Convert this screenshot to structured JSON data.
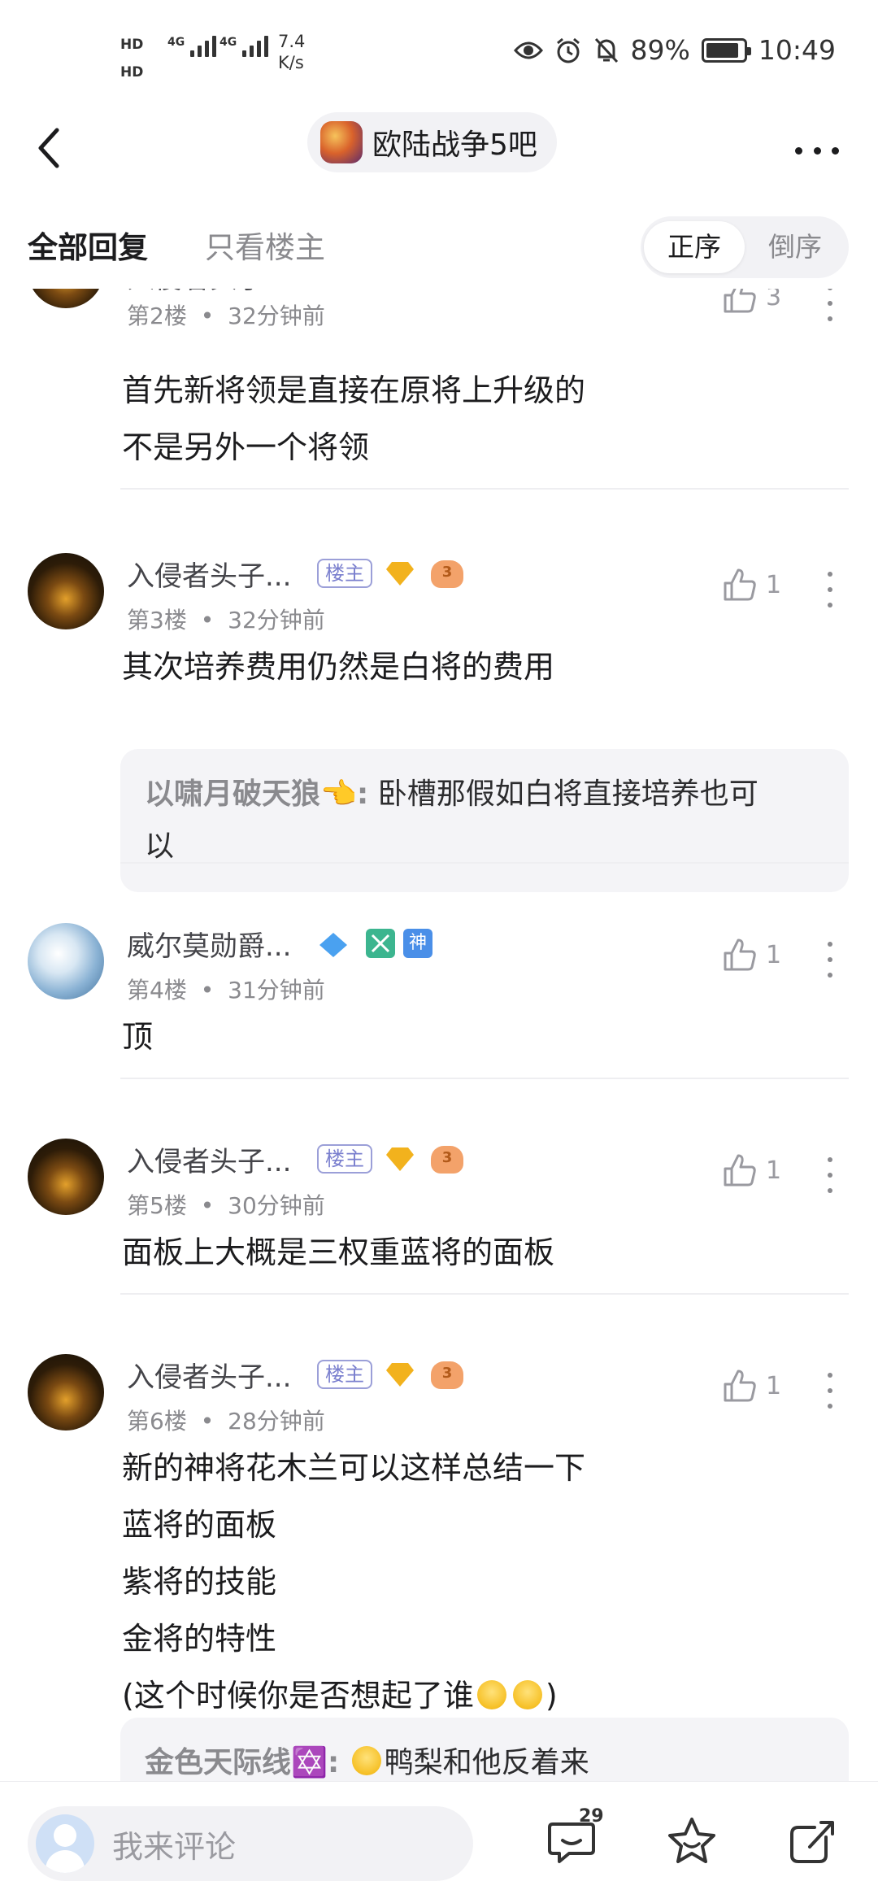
{
  "status_bar": {
    "hd1": "HD",
    "hd2": "HD",
    "sim1": "4G",
    "sim2": "4G",
    "speed_value": "7.4",
    "speed_unit": "K/s",
    "battery": "89%",
    "battery_level": 0.89,
    "time": "10:49",
    "icons": [
      "eye-icon",
      "alarm-icon",
      "bell-off-icon"
    ]
  },
  "header": {
    "forum_name": "欧陆战争5吧"
  },
  "tabs": {
    "all": "全部回复",
    "op_only": "只看楼主",
    "sort_asc": "正序",
    "sort_desc": "倒序"
  },
  "owner_badge": "楼主",
  "posts": [
    {
      "username": "入侵者头子...",
      "floor": "第2楼",
      "time": "32分钟前",
      "likes": "3",
      "lines": [
        "首先新将领是直接在原将上升级的",
        "不是另外一个将领"
      ]
    },
    {
      "username": "入侵者头子...",
      "floor": "第3楼",
      "time": "32分钟前",
      "likes": "1",
      "level": "11",
      "pad_level": "3",
      "lines": [
        "其次培养费用仍然是白将的费用"
      ],
      "reply": {
        "user": "以啸月破天狼👈:",
        "text_1": "卧槽那假如白将直接培养也可",
        "text_2": "以"
      }
    },
    {
      "username": "威尔莫勋爵...",
      "floor": "第4楼",
      "time": "31分钟前",
      "likes": "1",
      "gem_level": "4",
      "tag_god": "神",
      "lines": [
        "顶"
      ]
    },
    {
      "username": "入侵者头子...",
      "floor": "第5楼",
      "time": "30分钟前",
      "likes": "1",
      "level": "11",
      "pad_level": "3",
      "lines": [
        "面板上大概是三权重蓝将的面板"
      ]
    },
    {
      "username": "入侵者头子...",
      "floor": "第6楼",
      "time": "28分钟前",
      "likes": "1",
      "level": "11",
      "pad_level": "3",
      "lines": [
        "新的神将花木兰可以这样总结一下",
        "蓝将的面板",
        "紫将的技能",
        "金将的特性",
        "(这个时候你是否想起了谁",
        ")"
      ],
      "reply": {
        "user": "金色天际线✡️:",
        "text_1": "鸭梨和他反着来"
      }
    }
  ],
  "meta_sep": "•",
  "bottom_bar": {
    "placeholder": "我来评论",
    "comment_count": "29"
  }
}
